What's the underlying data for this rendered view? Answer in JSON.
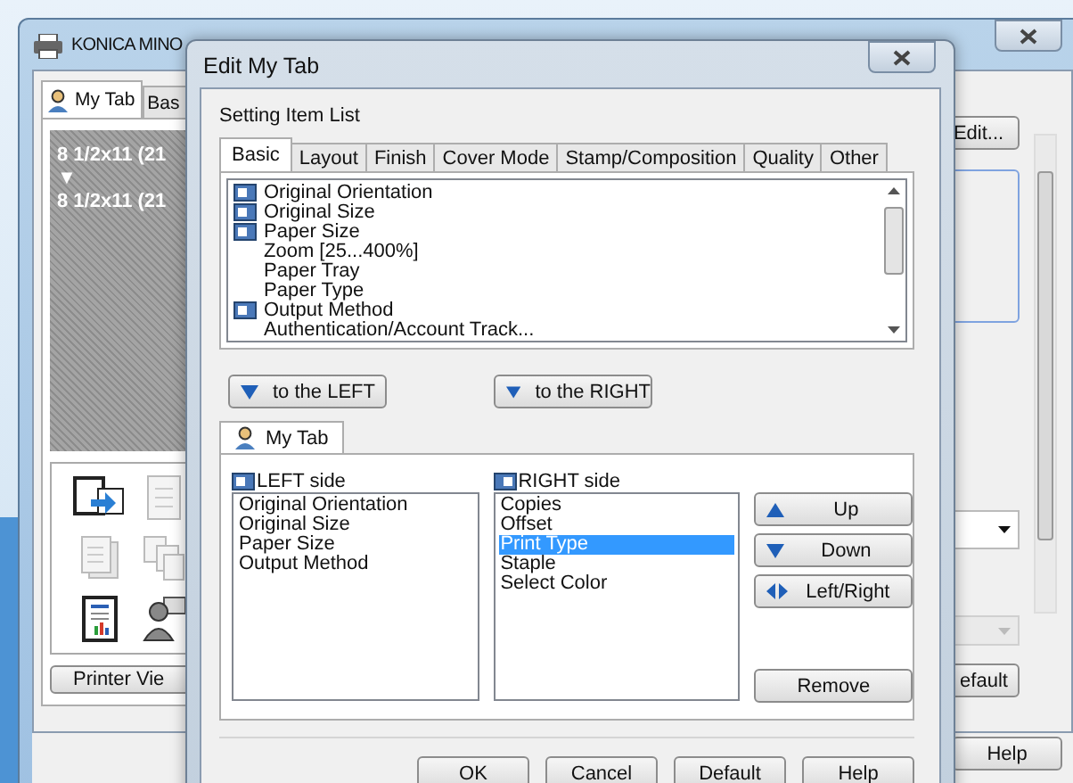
{
  "back_window": {
    "title": "KONICA MINO",
    "tabs": [
      {
        "label": "My Tab",
        "selected": true
      },
      {
        "label": "Bas",
        "selected": false
      }
    ],
    "preview_lines": [
      "8 1/2x11 (21",
      "▼",
      "8 1/2x11 (21"
    ],
    "printer_view_button": "Printer Vie",
    "edit_button": "Edit...",
    "dropdowns": [
      {
        "disabled": false
      },
      {
        "disabled": true
      }
    ],
    "default_button": "efault",
    "help_button": "Help"
  },
  "dialog": {
    "title": "Edit My Tab",
    "section_label": "Setting Item List",
    "tabs": [
      {
        "label": "Basic",
        "selected": true
      },
      {
        "label": "Layout",
        "selected": false
      },
      {
        "label": "Finish",
        "selected": false
      },
      {
        "label": "Cover Mode",
        "selected": false
      },
      {
        "label": "Stamp/Composition",
        "selected": false
      },
      {
        "label": "Quality",
        "selected": false
      },
      {
        "label": "Other",
        "selected": false
      }
    ],
    "items": [
      {
        "label": "Original Orientation",
        "marked": true
      },
      {
        "label": "Original Size",
        "marked": true
      },
      {
        "label": "Paper Size",
        "marked": true
      },
      {
        "label": "Zoom [25...400%]",
        "marked": false
      },
      {
        "label": "Paper Tray",
        "marked": false
      },
      {
        "label": "Paper Type",
        "marked": false
      },
      {
        "label": "Output Method",
        "marked": true
      },
      {
        "label": "Authentication/Account Track...",
        "marked": false
      }
    ],
    "move_buttons": [
      "to the LEFT",
      "to the RIGHT"
    ],
    "my_tab": {
      "tab": {
        "label": "My Tab",
        "selected": true
      },
      "left_label": "LEFT side",
      "left_items": [
        "Original Orientation",
        "Original Size",
        "Paper Size",
        "Output Method"
      ],
      "right_label": "RIGHT side",
      "right_items": [
        {
          "label": "Copies",
          "selected": false
        },
        {
          "label": "Offset",
          "selected": false
        },
        {
          "label": "Print Type",
          "selected": true
        },
        {
          "label": "Staple",
          "selected": false
        },
        {
          "label": "Select Color",
          "selected": false
        }
      ],
      "side_buttons": [
        {
          "label": "Up",
          "kind": "up"
        },
        {
          "label": "Down",
          "kind": "down"
        },
        {
          "label": "Left/Right",
          "kind": "leftright"
        },
        {
          "label": "Remove",
          "kind": "plain"
        }
      ]
    },
    "buttons": [
      "OK",
      "Cancel",
      "Default",
      "Help"
    ]
  }
}
